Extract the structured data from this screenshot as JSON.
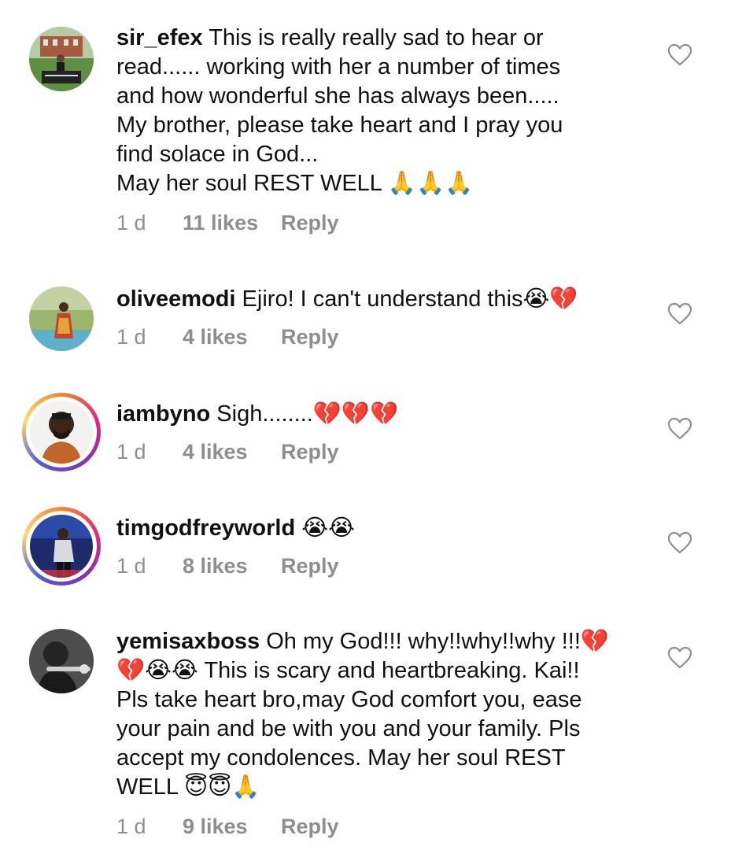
{
  "comments": [
    {
      "username": "sir_efex",
      "text": " This is really really sad to hear or\nread...... working with her a number of times\nand how wonderful she has always been.....\nMy brother, please take heart and I pray you\nfind solace in God...\nMay her soul REST WELL 🙏🙏🙏",
      "time": "1 d",
      "likes": "11 likes",
      "reply": "Reply",
      "like_icon": "heart-outline-icon"
    },
    {
      "username": "oliveemodi",
      "text": " Ejiro! I can't understand this😭💔",
      "time": "1 d",
      "likes": "4 likes",
      "reply": "Reply",
      "like_icon": "heart-outline-icon"
    },
    {
      "username": "iambyno",
      "text": " Sigh........💔💔💔",
      "time": "1 d",
      "likes": "4 likes",
      "reply": "Reply",
      "like_icon": "heart-outline-icon"
    },
    {
      "username": "timgodfreyworld",
      "text": " 😭😭",
      "time": "1 d",
      "likes": "8 likes",
      "reply": "Reply",
      "like_icon": "heart-outline-icon"
    },
    {
      "username": "yemisaxboss",
      "text": " Oh my God!!! why!!why!!why !!!💔\n💔😭😭 This is scary and heartbreaking. Kai!!\nPls take heart bro,may God comfort you, ease\nyour pain and be with you and your family. Pls\naccept my condolences. May her soul REST\nWELL 😇😇🙏",
      "time": "1 d",
      "likes": "9 likes",
      "reply": "Reply",
      "like_icon": "heart-outline-icon"
    }
  ]
}
